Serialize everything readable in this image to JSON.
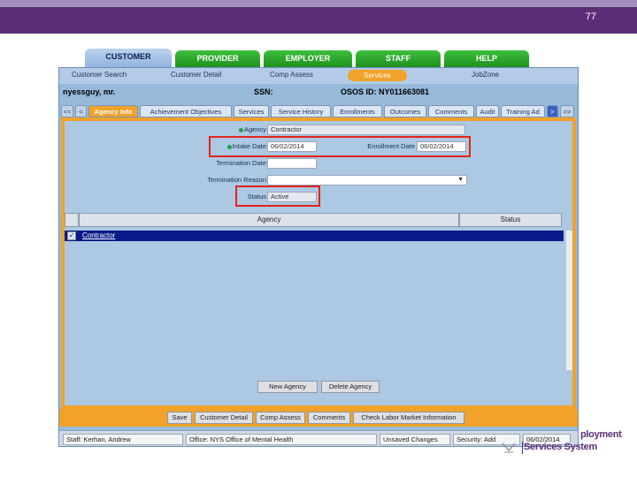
{
  "slide": {
    "number": "77"
  },
  "main_tabs": [
    {
      "label": "CUSTOMER",
      "active": true
    },
    {
      "label": "PROVIDER",
      "active": false
    },
    {
      "label": "EMPLOYER",
      "active": false
    },
    {
      "label": "STAFF",
      "active": false
    },
    {
      "label": "HELP",
      "active": false
    }
  ],
  "subnav": [
    {
      "label": "Customer Search",
      "active": false
    },
    {
      "label": "Customer Detail",
      "active": false
    },
    {
      "label": "Comp Assess",
      "active": false
    },
    {
      "label": "Services",
      "active": true
    },
    {
      "label": "JobZone",
      "active": false
    }
  ],
  "customer": {
    "name": "nyessguy, mr.",
    "ssn_label": "SSN:",
    "osos_label": "OSOS ID: NY011663081"
  },
  "inner_tabs": {
    "nav_left": [
      "<<",
      "<"
    ],
    "tabs": [
      "Agency Info",
      "Achievement Objectives",
      "Services",
      "Service History",
      "Enrollments",
      "Outcomes",
      "Comments",
      "Audit",
      "Training Ad"
    ],
    "active": "Agency Info",
    "nav_right": [
      ">",
      ">>"
    ]
  },
  "form": {
    "agency_label": "Agency",
    "agency_value": "Contractor",
    "intake_label": "Intake Date",
    "intake_value": "06/02/2014",
    "enrollment_label": "Enrollment Date",
    "enrollment_value": "06/02/2014",
    "termination_date_label": "Termination Date",
    "termination_date_value": "",
    "termination_reason_label": "Termination Reason",
    "termination_reason_value": "",
    "status_label": "Status",
    "status_value": "Active"
  },
  "table": {
    "headers": [
      "Agency",
      "Status"
    ],
    "rows": [
      {
        "checked": true,
        "agency": "Contractor",
        "status": ""
      }
    ]
  },
  "table_buttons": {
    "new": "New Agency",
    "delete": "Delete Agency"
  },
  "bottom_buttons": [
    "Save",
    "Customer Detail",
    "Comp Assess",
    "Comments",
    "Check Labor Market Information"
  ],
  "status_bar": {
    "staff": "Staff: Kerhan, Andrew",
    "office": "Office: NYS Office of Mental Health",
    "changes": "Unsaved Changes",
    "security": "Security: Add",
    "date": "06/02/2014"
  },
  "logo": {
    "line1": "ployment",
    "line2": "Services System"
  },
  "colors": {
    "header": "#5b2f77",
    "tab_green": "#2aa02a",
    "accent_orange": "#f1a22a",
    "highlight_red": "#e2231a",
    "selected_row": "#0b1a8a"
  }
}
